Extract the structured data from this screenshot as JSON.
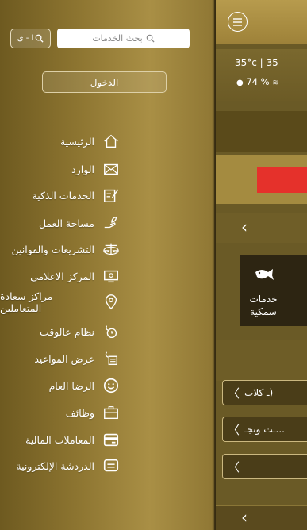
{
  "drawer": {
    "search_placeholder": "بحث الخدمات",
    "lang_label": "ا - ى",
    "login_label": "الدخول",
    "items": [
      {
        "label": "الرئيسية",
        "icon": "home-icon"
      },
      {
        "label": "الوارد",
        "icon": "mail-icon"
      },
      {
        "label": "الخدمات الذكية",
        "icon": "edit-document-icon"
      },
      {
        "label": "مساحة العمل",
        "icon": "hand-plant-icon"
      },
      {
        "label": "التشريعات والقوانين",
        "icon": "scales-icon"
      },
      {
        "label": "المركز الاعلامي",
        "icon": "monitor-icon"
      },
      {
        "label": "مراكز سعادة المتعاملين",
        "icon": "location-pin-icon"
      },
      {
        "label": "نظام عالوقت",
        "icon": "stopwatch-icon"
      },
      {
        "label": "عرض المواعيد",
        "icon": "calendar-clock-icon"
      },
      {
        "label": "الرضا العام",
        "icon": "smiley-icon"
      },
      {
        "label": "وظائف",
        "icon": "briefcase-icon"
      },
      {
        "label": "المعاملات المالية",
        "icon": "card-icon"
      },
      {
        "label": "الدردشة الإلكترونية",
        "icon": "chat-icon"
      }
    ]
  },
  "main": {
    "weather_temp": "35°c | 35",
    "humidity": "74 %",
    "tile_label": "خدمات سمكية",
    "list_rows": [
      "ـ كلاب)",
      "ـت وتجـ..."
    ]
  },
  "colors": {
    "accent_gold": "#a98f45",
    "banner_red": "#e5312b"
  }
}
